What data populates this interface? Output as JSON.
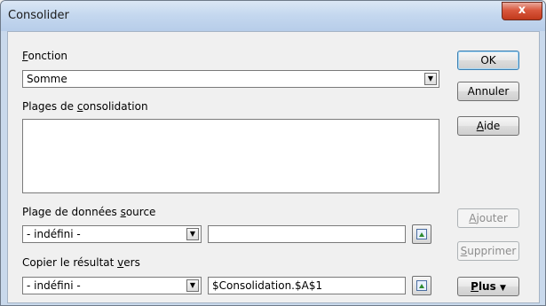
{
  "window": {
    "title": "Consolider",
    "close_glyph": "x"
  },
  "fonction": {
    "label_first": "F",
    "label_rest": "onction",
    "selected": "Somme"
  },
  "plages": {
    "label_pre": "Plages de ",
    "label_u": "c",
    "label_post": "onsolidation"
  },
  "source": {
    "label_pre": "Plage de données ",
    "label_u": "s",
    "label_post": "ource",
    "combo_value": "- indéfini -",
    "text_value": ""
  },
  "copy": {
    "label_pre": "Copier le résultat ",
    "label_u": "v",
    "label_post": "ers",
    "combo_value": "- indéfini -",
    "text_value": "$Consolidation.$A$1"
  },
  "buttons": {
    "ok": "OK",
    "annuler": "Annuler",
    "aide_u": "A",
    "aide_rest": "ide",
    "ajouter_u": "A",
    "ajouter_rest": "jouter",
    "supprimer_u": "S",
    "supprimer_rest": "upprimer",
    "plus_u": "P",
    "plus_rest": "lus",
    "plus_glyph": "▼"
  },
  "icons": {
    "dropdown": "chevron-down-icon",
    "shrink": "shrink-dialog-icon"
  }
}
